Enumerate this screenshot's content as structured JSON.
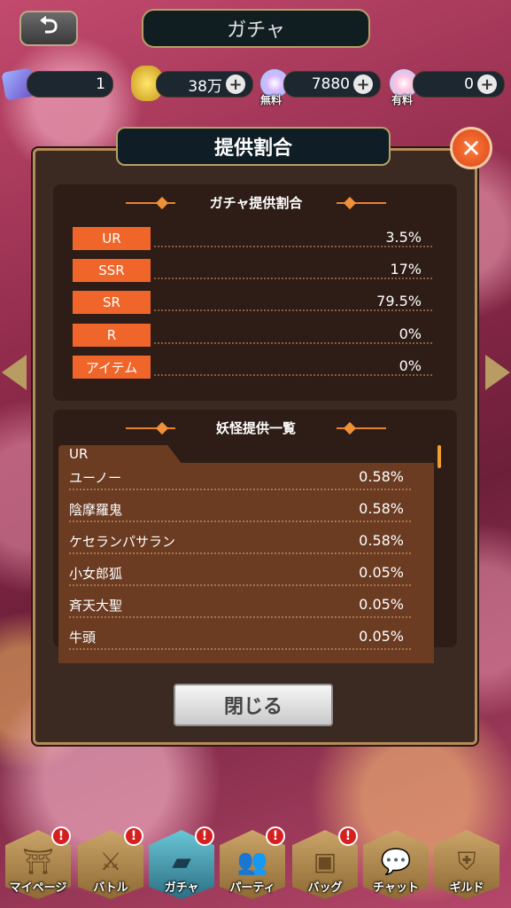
{
  "header": {
    "back_icon": "return-arrow-icon",
    "title": "ガチャ"
  },
  "resources": {
    "tickets": "1",
    "gold": "38万",
    "free_gems": "7880",
    "free_label": "無料",
    "paid_gems": "0",
    "paid_label": "有料"
  },
  "panel": {
    "title": "提供割合",
    "rates_title": "ガチャ提供割合",
    "rates": [
      {
        "label": "UR",
        "value": "3.5%"
      },
      {
        "label": "SSR",
        "value": "17%"
      },
      {
        "label": "SR",
        "value": "79.5%"
      },
      {
        "label": "R",
        "value": "0%"
      },
      {
        "label": "アイテム",
        "value": "0%"
      }
    ],
    "list_title": "妖怪提供一覧",
    "list_category": "UR",
    "list": [
      {
        "name": "ユーノー",
        "pct": "0.58%"
      },
      {
        "name": "陰摩羅鬼",
        "pct": "0.58%"
      },
      {
        "name": "ケセランパサラン",
        "pct": "0.58%"
      },
      {
        "name": "小女郎狐",
        "pct": "0.05%"
      },
      {
        "name": "斉天大聖",
        "pct": "0.05%"
      },
      {
        "name": "牛頭",
        "pct": "0.05%"
      }
    ],
    "close_button": "閉じる"
  },
  "nav": [
    {
      "label": "マイページ",
      "icon": "torii-icon",
      "glyph": "⛩",
      "badge": "!"
    },
    {
      "label": "バトル",
      "icon": "crossed-swords-icon",
      "glyph": "⚔",
      "badge": "!"
    },
    {
      "label": "ガチャ",
      "icon": "ticket-icon",
      "glyph": "▰",
      "badge": "!"
    },
    {
      "label": "パーティ",
      "icon": "group-icon",
      "glyph": "👥",
      "badge": "!"
    },
    {
      "label": "バッグ",
      "icon": "box-icon",
      "glyph": "▣",
      "badge": "!"
    },
    {
      "label": "チャット",
      "icon": "chat-bubble-icon",
      "glyph": "💬",
      "badge": ""
    },
    {
      "label": "ギルド",
      "icon": "shield-icon",
      "glyph": "⛨",
      "badge": ""
    }
  ],
  "colors": {
    "accent_orange": "#f0662a",
    "gold_border": "#b79f67",
    "panel_bg": "#3a2a22"
  }
}
